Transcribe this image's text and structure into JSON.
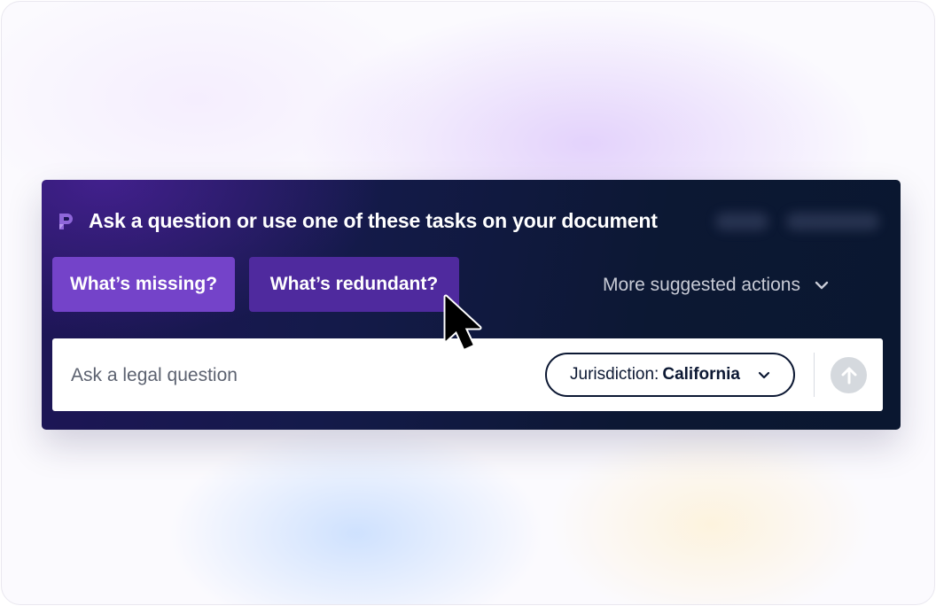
{
  "header": {
    "title": "Ask a question or use one of these tasks on your document",
    "logo_icon": "brand-p-logo-icon"
  },
  "suggestions": {
    "chips": [
      {
        "label": "What’s missing?"
      },
      {
        "label": "What’s redundant?"
      }
    ],
    "more_label": "More suggested actions"
  },
  "input": {
    "placeholder": "Ask a legal question",
    "jurisdiction_label": "Jurisdiction:",
    "jurisdiction_value": "California"
  },
  "colors": {
    "panel_bg": "#0c1833",
    "chip_primary": "#7443c9",
    "chip_secondary": "#4f2a9e",
    "send_disabled": "#d5d9de"
  }
}
